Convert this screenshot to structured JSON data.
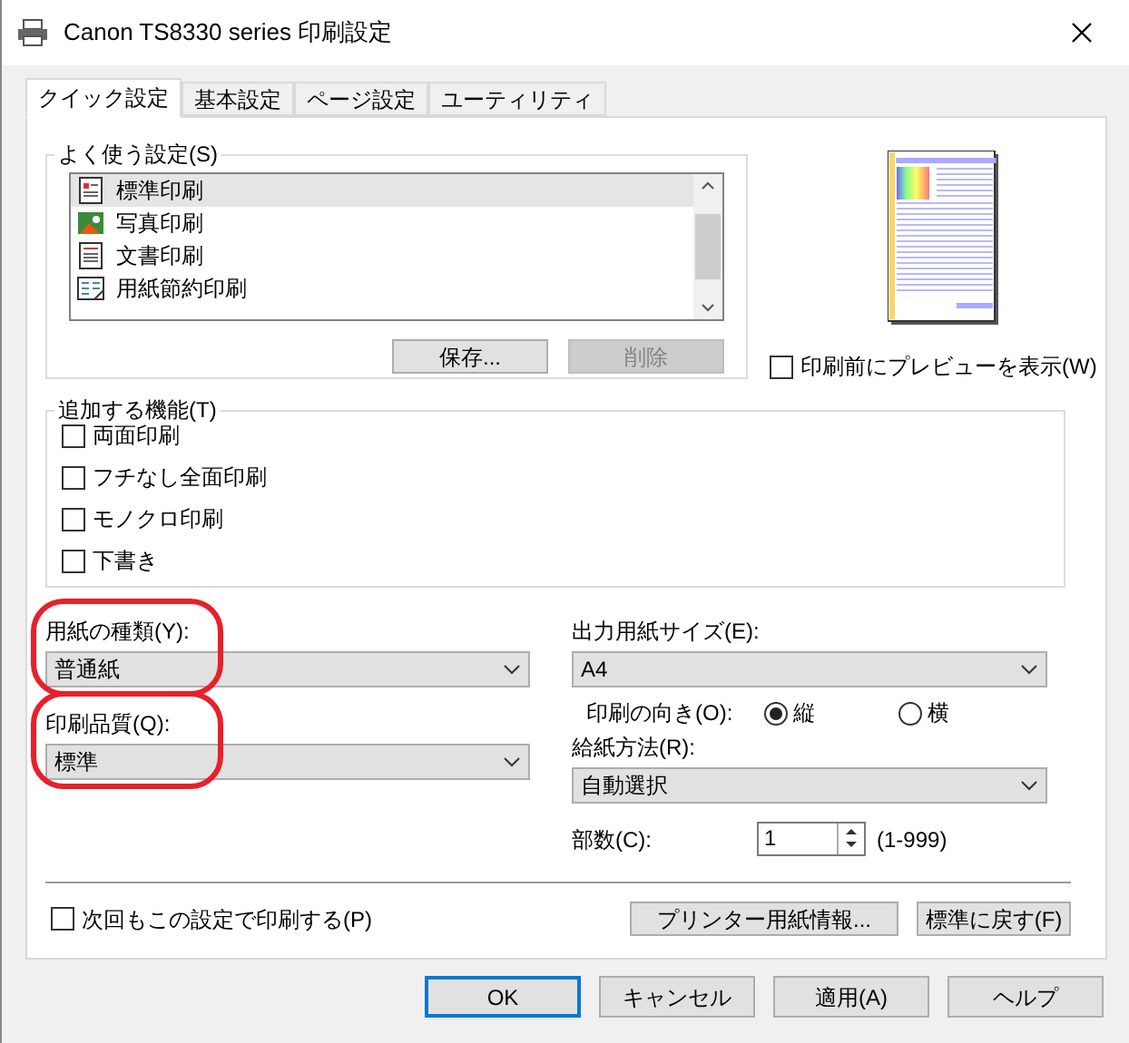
{
  "window": {
    "title": "Canon TS8330 series 印刷設定"
  },
  "tabs": [
    {
      "label": "クイック設定",
      "selected": true
    },
    {
      "label": "基本設定",
      "selected": false
    },
    {
      "label": "ページ設定",
      "selected": false
    },
    {
      "label": "ユーティリティ",
      "selected": false
    }
  ],
  "favorites": {
    "label": "よく使う設定(S)",
    "items": [
      {
        "label": "標準印刷",
        "kind": "standard",
        "selected": true
      },
      {
        "label": "写真印刷",
        "kind": "photo",
        "selected": false
      },
      {
        "label": "文書印刷",
        "kind": "document",
        "selected": false
      },
      {
        "label": "用紙節約印刷",
        "kind": "saving",
        "selected": false
      }
    ],
    "buttons": [
      {
        "label": "保存...",
        "disabled": false
      },
      {
        "label": "削除",
        "disabled": true
      }
    ]
  },
  "preview_checkbox": {
    "label": "印刷前にプレビューを表示(W)",
    "checked": false
  },
  "features": {
    "label": "追加する機能(T)",
    "items": [
      {
        "label": "両面印刷",
        "checked": false
      },
      {
        "label": "フチなし全面印刷",
        "checked": false
      },
      {
        "label": "モノクロ印刷",
        "checked": false
      },
      {
        "label": "下書き",
        "checked": false
      }
    ]
  },
  "paper_type": {
    "label": "用紙の種類(Y):",
    "value": "普通紙",
    "highlighted": true
  },
  "print_quality": {
    "label": "印刷品質(Q):",
    "value": "標準",
    "highlighted": true
  },
  "output_size": {
    "label": "出力用紙サイズ(E):",
    "value": "A4"
  },
  "orientation": {
    "label": "印刷の向き(O):",
    "options": [
      {
        "label": "縦",
        "selected": true
      },
      {
        "label": "横",
        "selected": false
      }
    ]
  },
  "paper_source": {
    "label": "給紙方法(R):",
    "value": "自動選択"
  },
  "copies": {
    "label": "部数(C):",
    "value": "1",
    "range": "(1-999)"
  },
  "remember_checkbox": {
    "label": "次回もこの設定で印刷する(P)",
    "checked": false
  },
  "panel_buttons": [
    "プリンター用紙情報...",
    "標準に戻す(F)"
  ],
  "dialog_buttons": [
    {
      "label": "OK",
      "default": true
    },
    {
      "label": "キャンセル",
      "default": false
    },
    {
      "label": "適用(A)",
      "default": false
    },
    {
      "label": "ヘルプ",
      "default": false
    }
  ]
}
